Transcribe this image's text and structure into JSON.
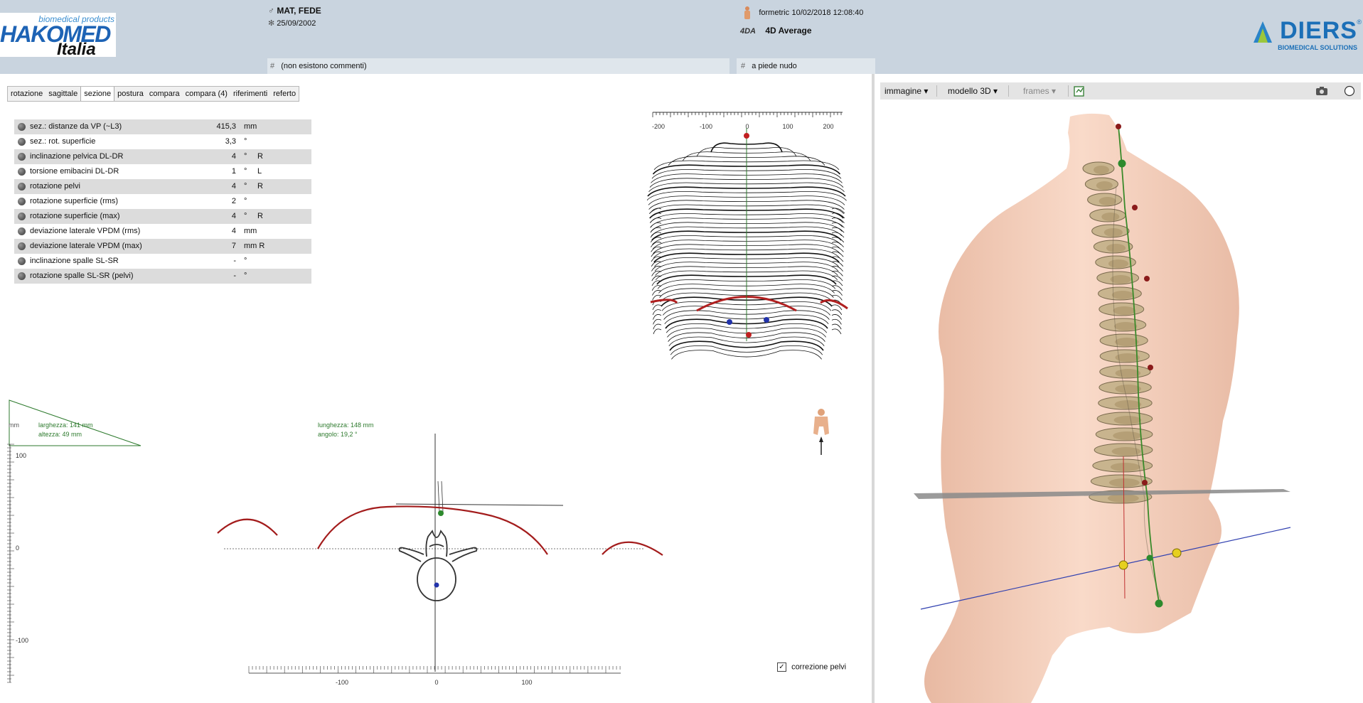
{
  "header": {
    "logo": {
      "top_text": "biomedical products",
      "main_text": "HAKOMED",
      "sub_text": "Italia"
    },
    "patient": {
      "gender_symbol": "♂",
      "name": "MAT, FEDE",
      "birth_symbol": "✻",
      "birth_date": "25/09/2002"
    },
    "measurement": {
      "type": "formetric",
      "datetime": "10/02/2018 12:08:40",
      "icon_text": "4DA",
      "mode": "4D Average"
    },
    "comment_left": {
      "hash": "#",
      "text": "(non esistono commenti)"
    },
    "comment_right": {
      "hash": "#",
      "text": "a piede nudo"
    },
    "brand": {
      "name": "DIERS",
      "reg": "®",
      "sub": "BIOMEDICAL SOLUTIONS"
    }
  },
  "tabs": [
    "rotazione",
    "sagittale",
    "sezione",
    "postura",
    "compara",
    "compara (4)",
    "riferimenti",
    "referto"
  ],
  "active_tab": "sezione",
  "params": [
    {
      "label": "sez.: distanze da VP (~L3)",
      "value": "415,3",
      "unit": "mm",
      "side": ""
    },
    {
      "label": "sez.: rot. superficie",
      "value": "3,3",
      "unit": "°",
      "side": ""
    },
    {
      "label": "inclinazione pelvica DL-DR",
      "value": "4",
      "unit": "°",
      "side": "R"
    },
    {
      "label": "torsione emibacini DL-DR",
      "value": "1",
      "unit": "°",
      "side": "L"
    },
    {
      "label": "rotazione pelvi",
      "value": "4",
      "unit": "°",
      "side": "R"
    },
    {
      "label": "rotazione superficie (rms)",
      "value": "2",
      "unit": "°",
      "side": ""
    },
    {
      "label": "rotazione superficie (max)",
      "value": "4",
      "unit": "°",
      "side": "R"
    },
    {
      "label": "deviazione laterale VPDM (rms)",
      "value": "4",
      "unit": "mm",
      "side": ""
    },
    {
      "label": "deviazione laterale VPDM (max)",
      "value": "7",
      "unit": "mm R",
      "side": ""
    },
    {
      "label": "inclinazione spalle SL-SR",
      "value": "-",
      "unit": "°",
      "side": ""
    },
    {
      "label": "rotazione spalle SL-SR (pelvi)",
      "value": "-",
      "unit": "°",
      "side": ""
    }
  ],
  "triangle": {
    "unit": "mm",
    "width_label": "larghezza: 141 mm",
    "height_label": "altezza: 49 mm"
  },
  "section_info": {
    "length_label": "lunghezza: 148 mm",
    "angle_label": "angolo: 19,2 °"
  },
  "section_axis": {
    "y_ticks": [
      "100",
      "0",
      "-100"
    ],
    "x_ticks": [
      "-100",
      "0",
      "100"
    ]
  },
  "contour_axis": {
    "x_ticks": [
      "-200",
      "-100",
      "0",
      "100",
      "200"
    ]
  },
  "correction": {
    "label": "correzione pelvi",
    "checked": true,
    "check_glyph": "✓"
  },
  "toolbar3d": {
    "image": "immagine ▾",
    "model": "modello 3D ▾",
    "frames": "frames ▾"
  },
  "colors": {
    "header_bg": "#c9d4df",
    "skin": "#f6d3c0",
    "bone": "#c8b48e",
    "line_green": "#2d7a2d",
    "curve_red": "#a31c1c"
  }
}
